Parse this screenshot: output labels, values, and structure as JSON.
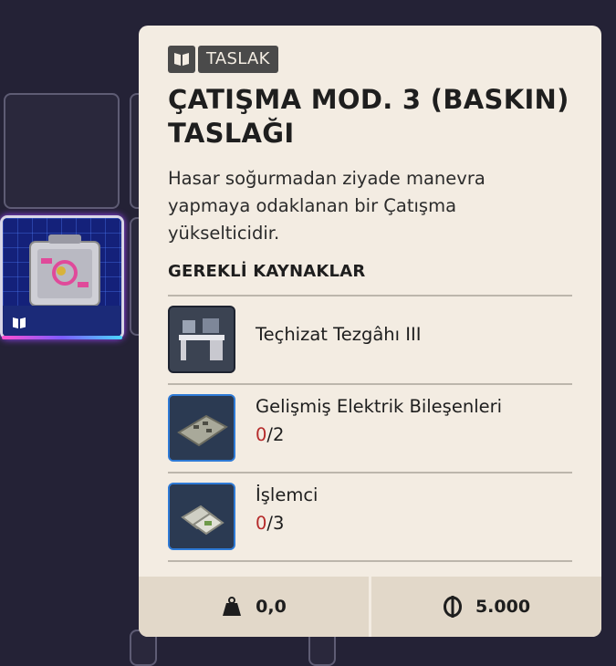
{
  "background": {
    "color": "#242236"
  },
  "inventory": {
    "selected_item": {
      "icon": "blueprint-book-icon",
      "accent": "#9b46ff"
    }
  },
  "tooltip": {
    "badge_icon": "book-icon",
    "badge_label": "TASLAK",
    "title": "ÇATIŞMA MOD. 3 (BASKIN) TASLAĞI",
    "description": "Hasar soğurmadan ziyade manevra yapmaya odaklanan bir Çatışma yükselticidir.",
    "requirements_title": "GEREKLİ KAYNAKLAR",
    "requirements": [
      {
        "name": "Teçhizat Tezgâhı III",
        "icon": "workbench-icon"
      },
      {
        "name": "Gelişmiş Elektrik Bileşenleri",
        "have": "0",
        "need": "/2",
        "icon": "circuit-board-icon"
      },
      {
        "name": "İşlemci",
        "have": "0",
        "need": "/3",
        "icon": "processor-icon"
      }
    ],
    "weight": "0,0",
    "weight_icon": "weight-icon",
    "price": "5.000",
    "price_icon": "coin-icon",
    "colors": {
      "card_bg": "#f3ece2",
      "missing": "#b52a2a",
      "footer_bg": "#e2d8c9"
    }
  }
}
